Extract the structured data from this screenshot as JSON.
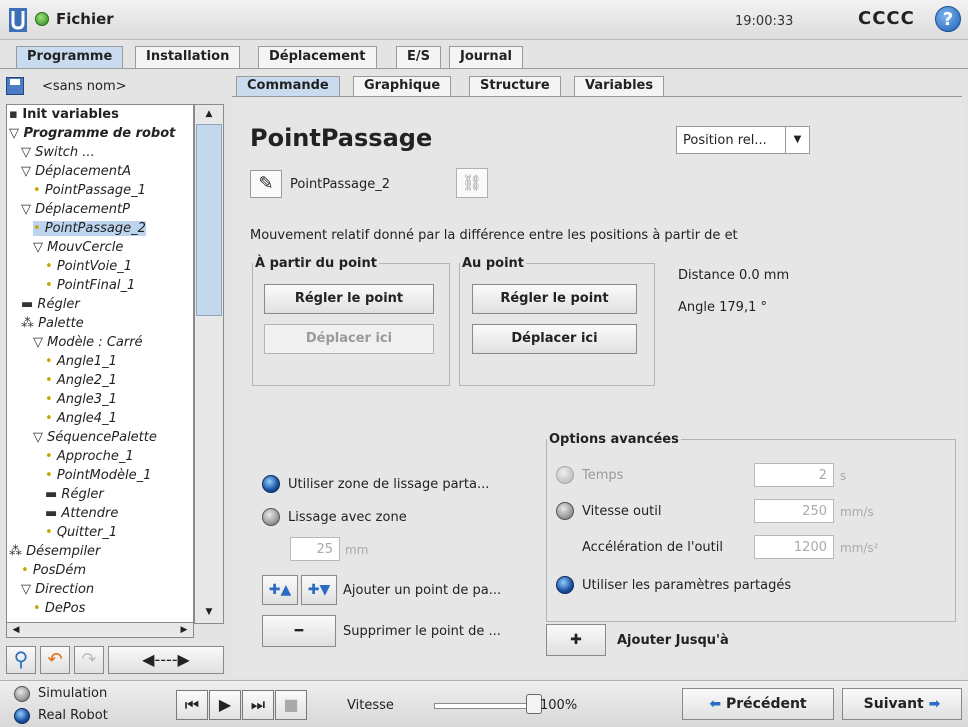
{
  "titlebar": {
    "file_menu": "Fichier",
    "clock": "19:00:33",
    "robot_name": "CCCC",
    "help": "?"
  },
  "main_tabs": [
    {
      "label": "Programme",
      "active": true
    },
    {
      "label": "Installation",
      "active": false
    },
    {
      "label": "Déplacement",
      "active": false
    },
    {
      "label": "E/S",
      "active": false
    },
    {
      "label": "Journal",
      "active": false
    }
  ],
  "left": {
    "program_name": "<sans nom>",
    "tree": [
      {
        "text": "Init variables",
        "style": "b",
        "marker": "▪"
      },
      {
        "text": "Programme de robot",
        "style": "b it",
        "marker": "▽"
      },
      {
        "text": "Switch ...",
        "style": "it",
        "marker": "▽"
      },
      {
        "text": "DéplacementA",
        "style": "it",
        "marker": "▽"
      },
      {
        "text": "PointPassage_1",
        "style": "it",
        "marker": "•"
      },
      {
        "text": "DéplacementP",
        "style": "it",
        "marker": "▽"
      },
      {
        "text": "PointPassage_2",
        "style": "it",
        "marker": "•"
      },
      {
        "text": "MouvCercle",
        "style": "it",
        "marker": "▽"
      },
      {
        "text": "PointVoie_1",
        "style": "it",
        "marker": "•"
      },
      {
        "text": "PointFinal_1",
        "style": "it",
        "marker": "•"
      },
      {
        "text": "Régler",
        "style": "it",
        "marker": "▬"
      },
      {
        "text": "Palette",
        "style": "it",
        "marker": "⁂"
      },
      {
        "text": "Modèle : Carré",
        "style": "it",
        "marker": "▽"
      },
      {
        "text": "Angle1_1",
        "style": "it",
        "marker": "•"
      },
      {
        "text": "Angle2_1",
        "style": "it",
        "marker": "•"
      },
      {
        "text": "Angle3_1",
        "style": "it",
        "marker": "•"
      },
      {
        "text": "Angle4_1",
        "style": "it",
        "marker": "•"
      },
      {
        "text": "SéquencePalette",
        "style": "it",
        "marker": "▽"
      },
      {
        "text": "Approche_1",
        "style": "it",
        "marker": "•"
      },
      {
        "text": "PointModèle_1",
        "style": "it",
        "marker": "•"
      },
      {
        "text": "Régler",
        "style": "it",
        "marker": "▬"
      },
      {
        "text": "Attendre",
        "style": "it",
        "marker": "▬"
      },
      {
        "text": "Quitter_1",
        "style": "it",
        "marker": "•"
      },
      {
        "text": "Désempiler",
        "style": "it",
        "marker": "⁂"
      },
      {
        "text": "PosDém",
        "style": "it",
        "marker": "•"
      },
      {
        "text": "Direction",
        "style": "it",
        "marker": "▽"
      },
      {
        "text": "DePos",
        "style": "it",
        "marker": "•"
      }
    ]
  },
  "sub_tabs": [
    {
      "label": "Commande",
      "active": true
    },
    {
      "label": "Graphique",
      "active": false
    },
    {
      "label": "Structure",
      "active": false
    },
    {
      "label": "Variables",
      "active": false
    }
  ],
  "command": {
    "title": "PointPassage",
    "position_select": "Position rel...",
    "waypoint_name": "PointPassage_2",
    "description": "Mouvement relatif donné par la différence entre les positions à partir de et",
    "from_point": {
      "legend": "À partir du point",
      "set_button": "Régler le point",
      "move_button": "Déplacer ici"
    },
    "to_point": {
      "legend": "Au point",
      "set_button": "Régler le point",
      "move_button": "Déplacer ici"
    },
    "distance": "Distance 0.0 mm",
    "angle": "Angle 179,1 °",
    "blend_shared": "Utiliser zone de lissage parta...",
    "blend_zone": "Lissage avec zone",
    "blend_value": "25",
    "blend_unit": "mm",
    "add_waypoint": "Ajouter un point de pa...",
    "remove_waypoint": "Supprimer le point de ...",
    "advanced": {
      "legend": "Options avancées",
      "time_label": "Temps",
      "time_value": "2",
      "time_unit": "s",
      "tool_speed_label": "Vitesse outil",
      "tool_speed_value": "250",
      "tool_speed_unit": "mm/s",
      "tool_accel_label": "Accélération de l'outil",
      "tool_accel_value": "1200",
      "tool_accel_unit": "mm/s²",
      "shared_params": "Utiliser les paramètres partagés"
    },
    "add_until": "Ajouter Jusqu'à"
  },
  "bottom": {
    "simulation": "Simulation",
    "real_robot": "Real Robot",
    "speed_label": "Vitesse",
    "speed_value": "100%",
    "speed_fraction": 1.0,
    "previous": "Précédent",
    "next": "Suivant"
  }
}
